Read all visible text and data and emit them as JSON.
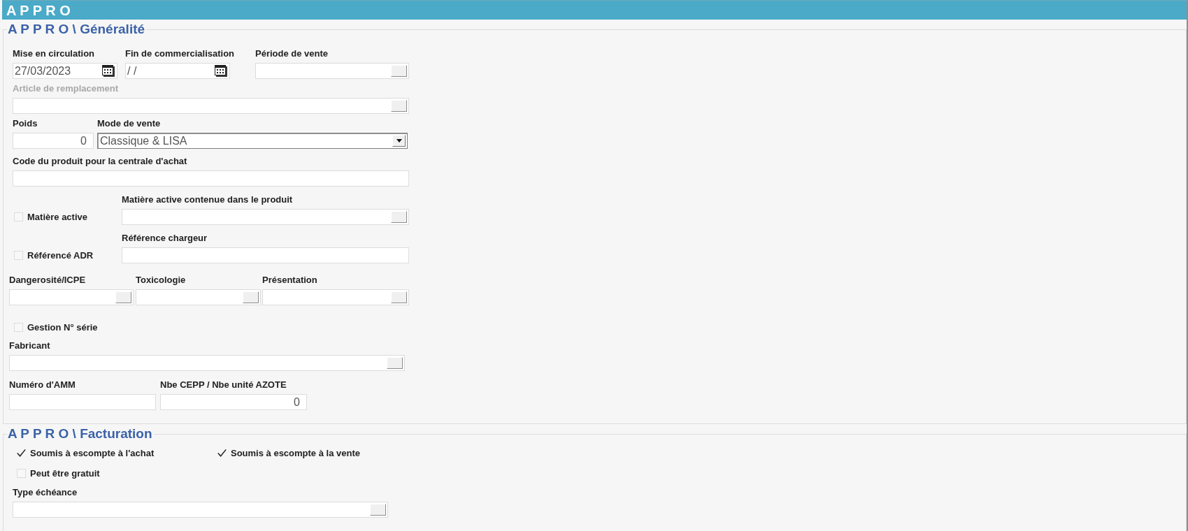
{
  "header": {
    "title": "A P P R O"
  },
  "sections": [
    {
      "title": "A P P R O \\ Généralité",
      "rows": [
        {
          "items": [
            {
              "kind": "date",
              "label": "Mise en circulation",
              "disabled": false,
              "value": "27/03/2023"
            },
            {
              "kind": "date",
              "label": "Fin de commercialisation",
              "disabled": false,
              "value": "/ /"
            },
            {
              "kind": "lookup",
              "label": "Période de vente",
              "disabled": false
            }
          ]
        },
        {
          "items": [
            {
              "kind": "lookup",
              "label": "Article de remplacement",
              "disabled": true
            }
          ]
        },
        {
          "items": [
            {
              "kind": "number",
              "label": "Poids",
              "disabled": false,
              "value": "0"
            },
            {
              "kind": "select",
              "label": "Mode de vente",
              "disabled": false,
              "value": "Classique & LISA"
            }
          ]
        },
        {
          "items": [
            {
              "kind": "text",
              "label": "Code du produit pour la centrale d'achat",
              "disabled": false
            }
          ]
        },
        {
          "items": [
            {
              "kind": "checkbox",
              "label": "Matière active",
              "disabled": false,
              "checked": false
            },
            {
              "kind": "lookup",
              "label": "Matière active contenue dans le produit",
              "disabled": false
            }
          ]
        },
        {
          "items": [
            {
              "kind": "checkbox",
              "label": "Référencé ADR",
              "disabled": false,
              "checked": false
            },
            {
              "kind": "text",
              "label": "Référence chargeur",
              "disabled": false
            }
          ]
        },
        {
          "items": [
            {
              "kind": "lookup",
              "label": "Dangerosité/ICPE",
              "disabled": false
            },
            {
              "kind": "lookup",
              "label": "Toxicologie",
              "disabled": false
            },
            {
              "kind": "lookup",
              "label": "Présentation",
              "disabled": false
            }
          ]
        },
        {
          "items": [
            {
              "kind": "checkbox",
              "label": "Gestion N° série",
              "disabled": false,
              "checked": false
            }
          ]
        },
        {
          "items": [
            {
              "kind": "lookup",
              "label": "Fabricant",
              "disabled": false
            }
          ]
        },
        {
          "items": [
            {
              "kind": "text",
              "label": "Numéro d'AMM",
              "disabled": false
            },
            {
              "kind": "number",
              "label": "Nbe CEPP / Nbe unité AZOTE",
              "disabled": false,
              "value": "0"
            }
          ]
        }
      ]
    },
    {
      "title": "A P P R O \\ Facturation",
      "rows": [
        {
          "items": [
            {
              "kind": "checkbox",
              "label": "Soumis à escompte à l'achat",
              "disabled": false,
              "checked": true
            },
            {
              "kind": "checkbox",
              "label": "Soumis à escompte à la vente",
              "disabled": false,
              "checked": true
            }
          ]
        },
        {
          "items": [
            {
              "kind": "checkbox",
              "label": "Peut être gratuit",
              "disabled": false,
              "checked": false
            }
          ]
        },
        {
          "items": [
            {
              "kind": "lookup",
              "label": "Type échéance",
              "disabled": false
            }
          ]
        }
      ]
    }
  ]
}
